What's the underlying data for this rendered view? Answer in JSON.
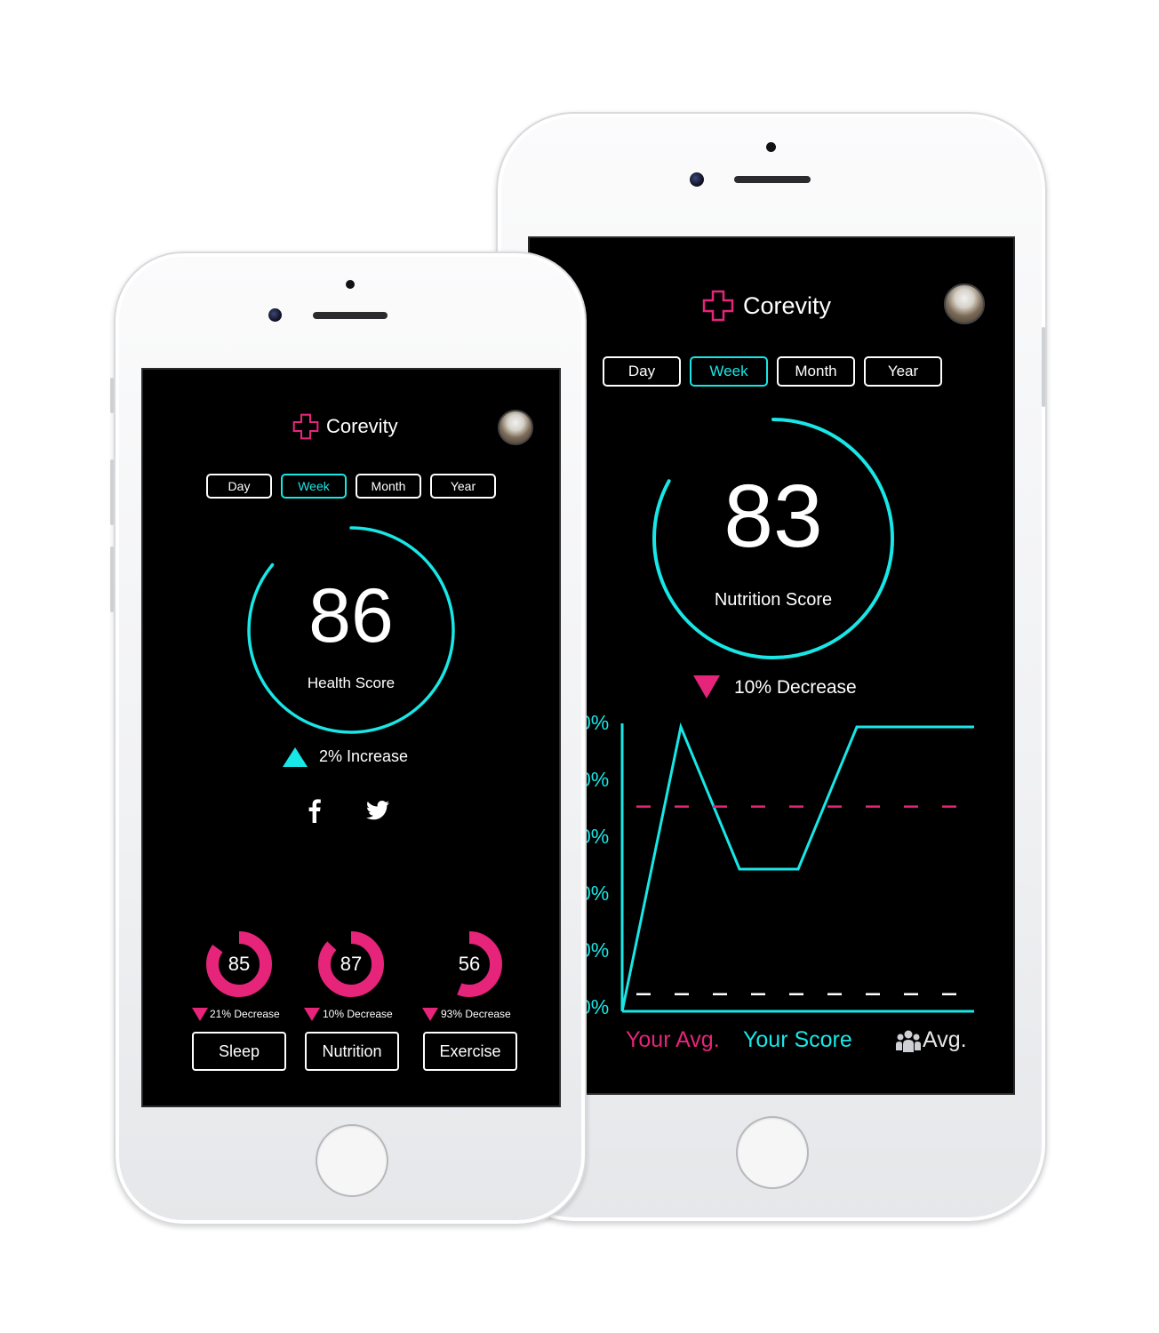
{
  "colors": {
    "accent": "#19e6e6",
    "highlight": "#e5247a",
    "background": "#000000",
    "text": "#ffffff"
  },
  "icons": {
    "logo": "medical-cross-icon",
    "share1": "facebook-icon",
    "share2": "twitter-icon",
    "community": "people-icon"
  },
  "front": {
    "app_title": "Corevity",
    "tabs": [
      {
        "label": "Day",
        "active": false
      },
      {
        "label": "Week",
        "active": true
      },
      {
        "label": "Month",
        "active": false
      },
      {
        "label": "Year",
        "active": false
      }
    ],
    "score": {
      "value": "86",
      "label": "Health Score",
      "fill_percent": 86
    },
    "trend": {
      "direction": "up",
      "text": "2% Increase"
    },
    "categories": [
      {
        "score": "85",
        "fill_percent": 85,
        "change": "21% Decrease",
        "button": "Sleep"
      },
      {
        "score": "87",
        "fill_percent": 87,
        "change": "10% Decrease",
        "button": "Nutrition"
      },
      {
        "score": "56",
        "fill_percent": 56,
        "change": "93% Decrease",
        "button": "Exercise"
      }
    ]
  },
  "back": {
    "app_title": "Corevity",
    "tabs": [
      {
        "label": "Day",
        "active": false
      },
      {
        "label": "Week",
        "active": true
      },
      {
        "label": "Month",
        "active": false
      },
      {
        "label": "Year",
        "active": false
      }
    ],
    "score": {
      "value": "83",
      "label": "Nutrition Score",
      "fill_percent": 83
    },
    "trend": {
      "direction": "down",
      "text": "10% Decrease"
    },
    "legend": {
      "your_avg": "Your Avg.",
      "your_score": "Your Score",
      "community_avg": "Avg."
    }
  },
  "chart_data": {
    "type": "line",
    "y_tick_labels": [
      "0%",
      "0%",
      "0%",
      "0%",
      "0%",
      "0%"
    ],
    "ylim": [
      0,
      100
    ],
    "series": [
      {
        "name": "Your Score",
        "color": "#19e6e6",
        "style": "solid",
        "x": [
          0,
          1,
          2,
          3,
          4,
          5,
          6
        ],
        "values": [
          0,
          100,
          50,
          50,
          100,
          100,
          100
        ]
      },
      {
        "name": "Your Avg.",
        "color": "#e5247a",
        "style": "dashed",
        "x": [
          0,
          6
        ],
        "values": [
          72,
          72
        ]
      },
      {
        "name": "Avg.",
        "color": "#ffffff",
        "style": "dashed",
        "x": [
          0,
          6
        ],
        "values": [
          6,
          6
        ]
      }
    ],
    "grid": false
  }
}
